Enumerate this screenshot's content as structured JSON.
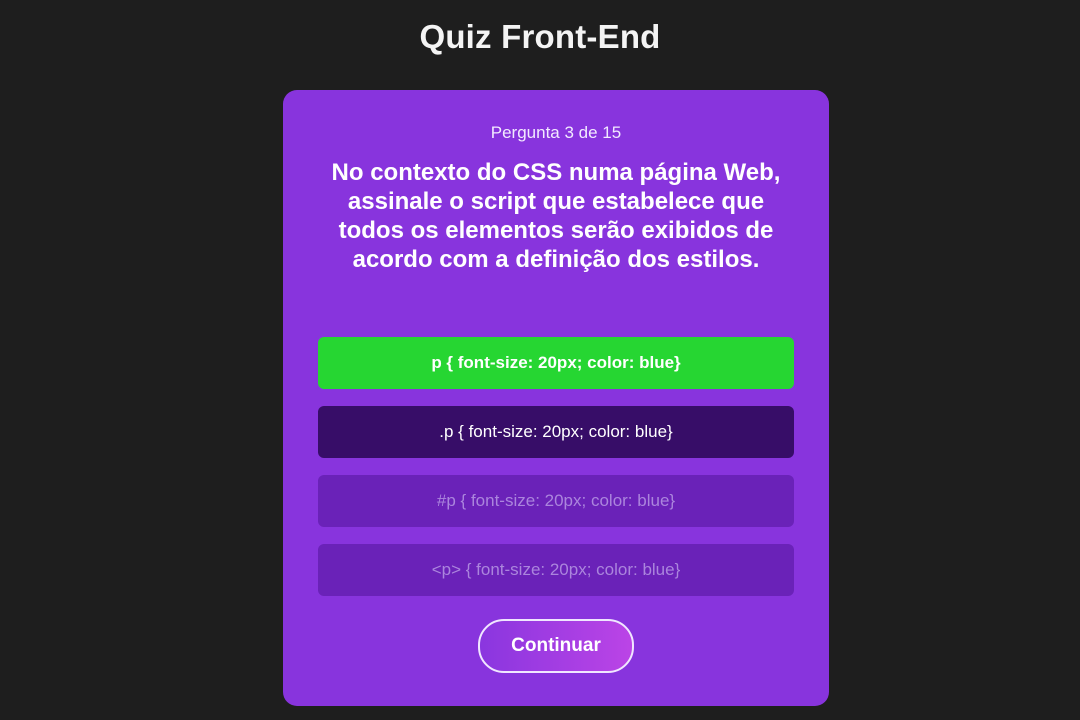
{
  "app": {
    "title": "Quiz Front-End"
  },
  "quiz": {
    "progress_text": "Pergunta 3 de 15",
    "current_question": 3,
    "total_questions": 15,
    "question": "No contexto do CSS numa página Web, assinale o script que estabelece que todos os elementos serão exibidos de acordo com a definição dos estilos.",
    "options": [
      {
        "label": "p { font-size: 20px; color: blue}",
        "state": "correct"
      },
      {
        "label": ".p { font-size: 20px; color: blue}",
        "state": "selected"
      },
      {
        "label": "#p { font-size: 20px; color: blue}",
        "state": "disabled"
      },
      {
        "label": "<p> { font-size: 20px; color: blue}",
        "state": "disabled"
      }
    ],
    "continue_label": "Continuar"
  },
  "colors": {
    "background": "#1e1e1e",
    "card": "#8834dd",
    "correct": "#26d632",
    "selected": "#370d68",
    "disabled": "#6a22b8"
  }
}
